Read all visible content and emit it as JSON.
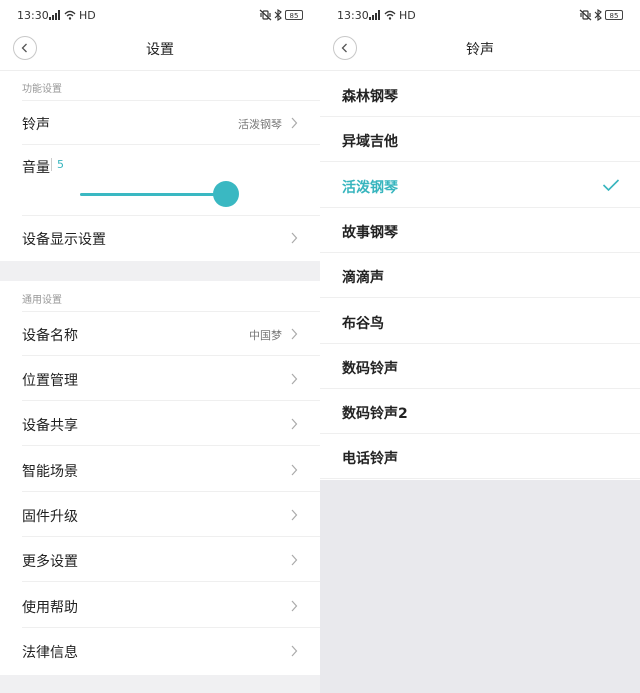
{
  "status_bar": {
    "time": "13:30",
    "network": "HD",
    "battery": "85"
  },
  "settings": {
    "title": "设置",
    "section_function": "功能设置",
    "ringtone": {
      "label": "铃声",
      "value": "活泼钢琴"
    },
    "volume": {
      "label": "音量",
      "value": "5",
      "level_fraction": 0.97
    },
    "display_settings": "设备显示设置",
    "section_general": "通用设置",
    "device_name": {
      "label": "设备名称",
      "value": "中国梦"
    },
    "general_items": [
      "位置管理",
      "设备共享",
      "智能场景",
      "固件升级",
      "更多设置",
      "使用帮助",
      "法律信息"
    ]
  },
  "ringtone_page": {
    "title": "铃声",
    "options": [
      "森林钢琴",
      "异域吉他",
      "活泼钢琴",
      "故事钢琴",
      "滴滴声",
      "布谷鸟",
      "数码铃声",
      "数码铃声2",
      "电话铃声"
    ],
    "selected_index": 2
  },
  "colors": {
    "accent": "#37b5be",
    "divider": "#efefef",
    "background_gray": "#f0f0f2"
  }
}
